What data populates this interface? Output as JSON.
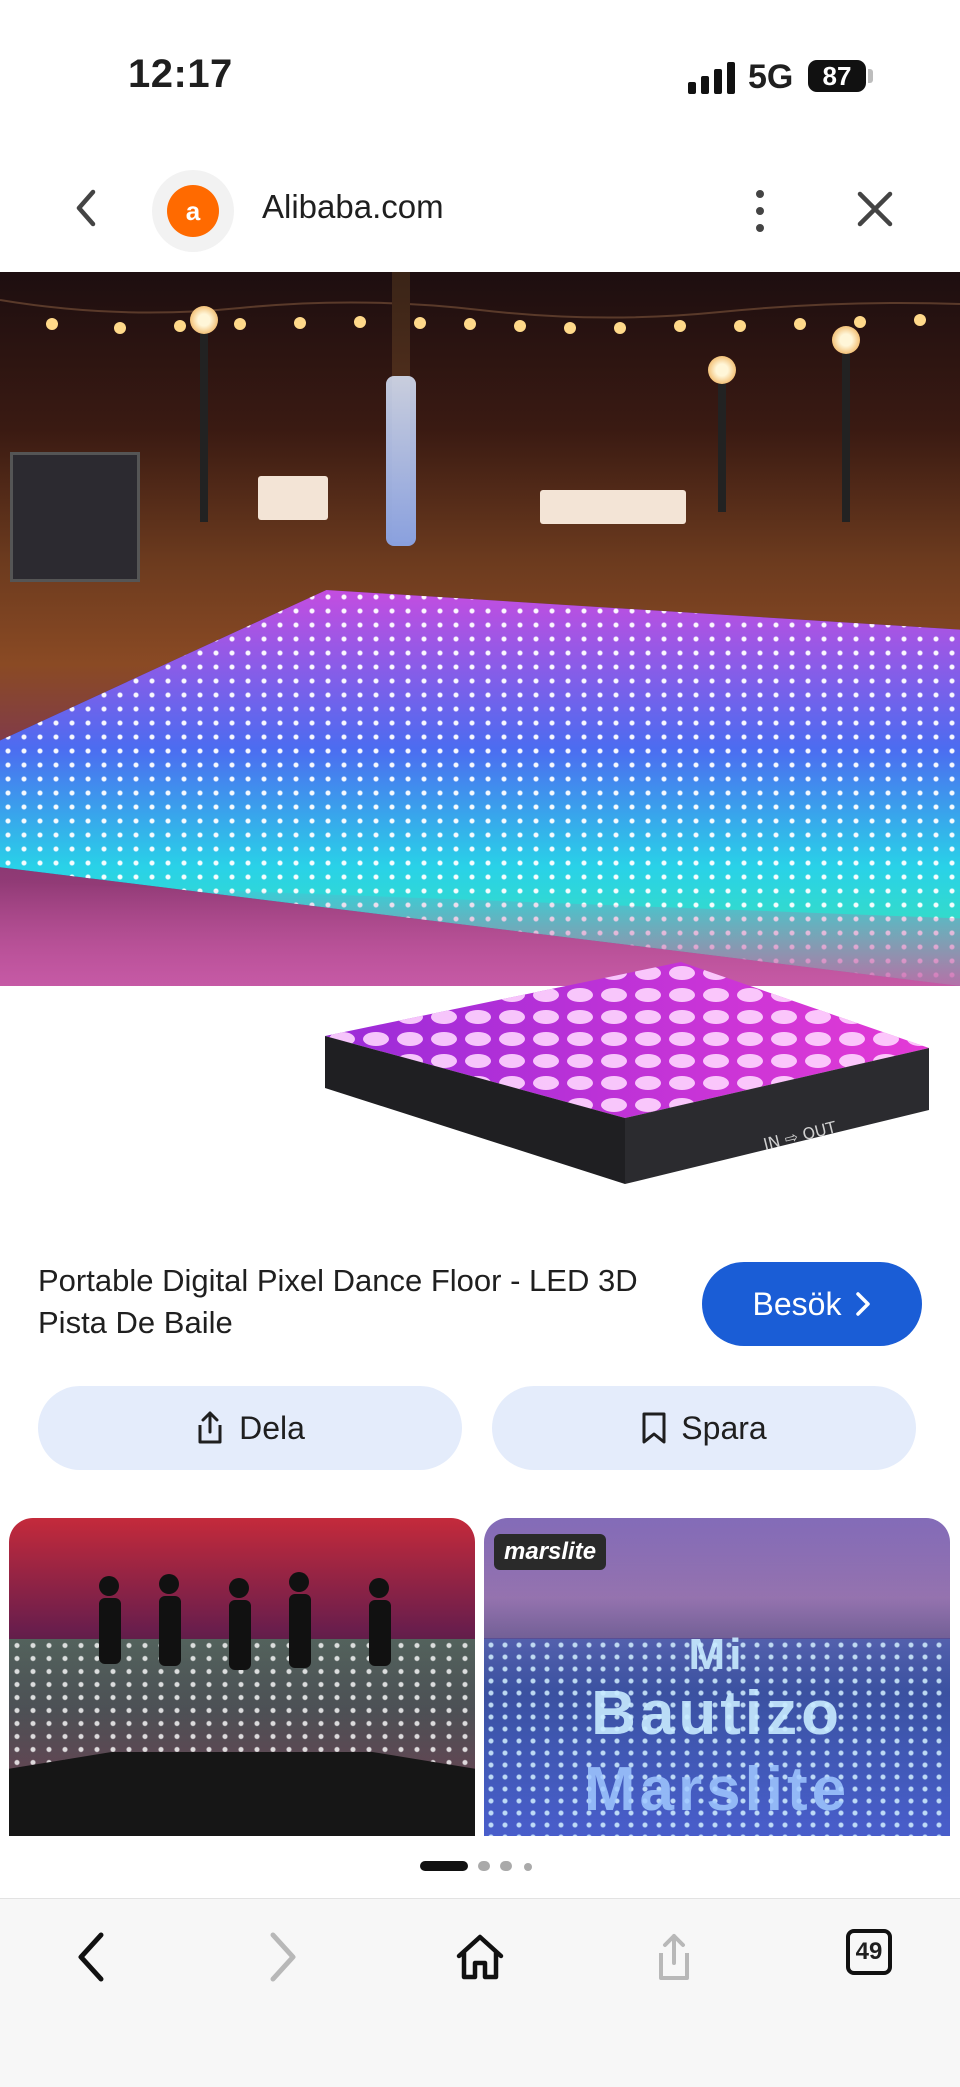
{
  "status_bar": {
    "time": "12:17",
    "network": "5G",
    "battery": "87"
  },
  "header": {
    "site_name": "Alibaba.com",
    "back_icon": "chevron-left-icon",
    "more_icon": "more-vert-icon",
    "close_icon": "close-icon"
  },
  "product": {
    "title": "Portable Digital Pixel Dance Floor - LED 3D Pista De Baile",
    "visit_label": "Besök",
    "share_label": "Dela",
    "save_label": "Spara"
  },
  "related": {
    "brand": "marslite",
    "floor_text_top": "Mi",
    "floor_text_mid": "Bautizo",
    "floor_text_bottom": "Marslite"
  },
  "pager": {
    "active_index": 0,
    "count": 4
  },
  "browser_bar": {
    "tabs_count": "49"
  },
  "colors": {
    "accent": "#1a5dd6",
    "action_bg": "#e4ecfb",
    "brand_orange": "#ff6a00"
  }
}
